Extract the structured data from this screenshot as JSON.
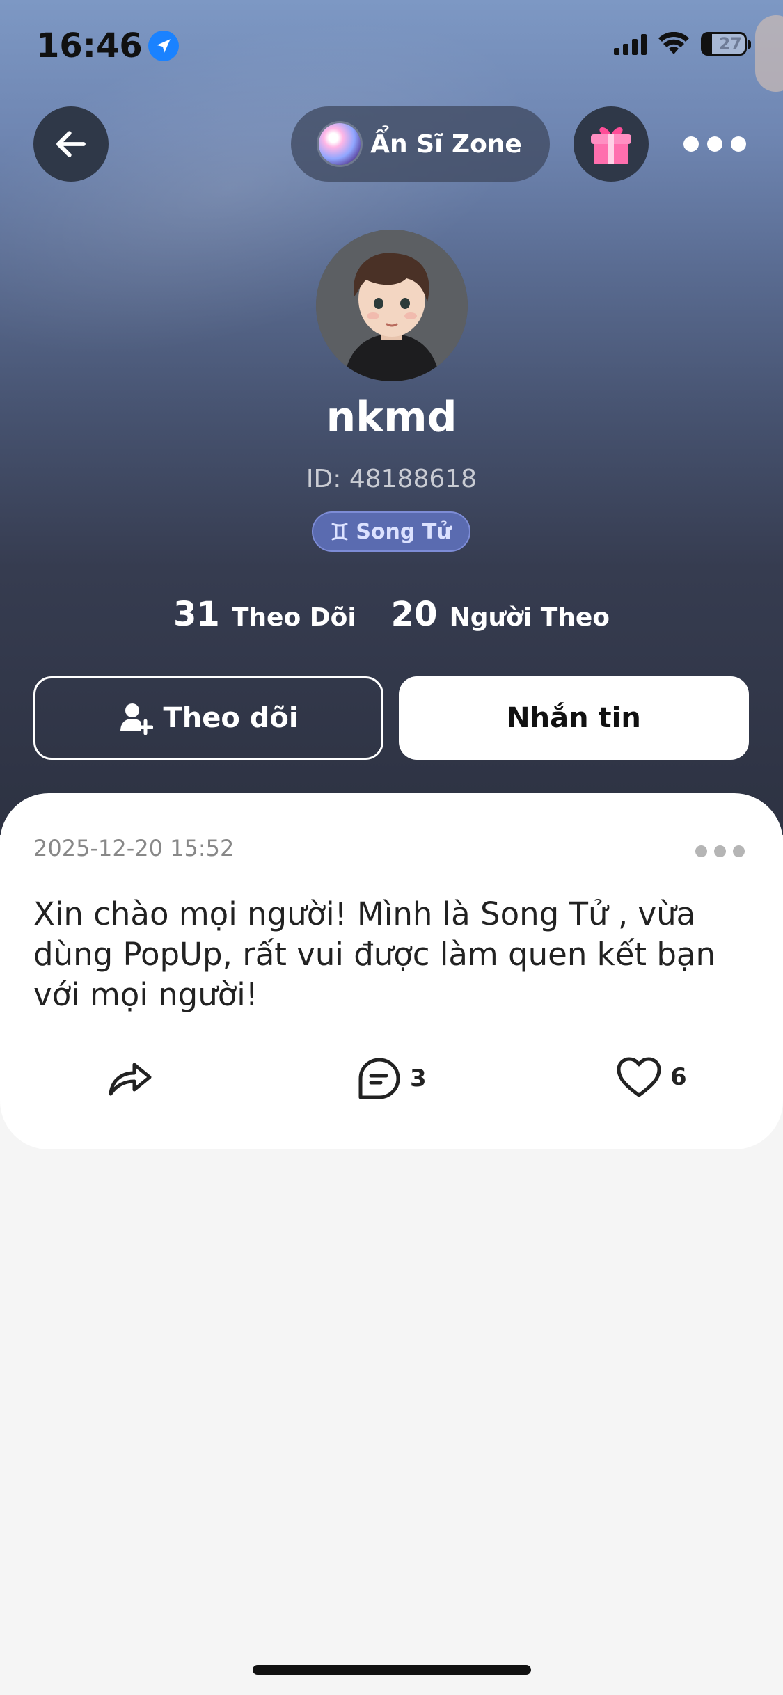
{
  "status_bar": {
    "time": "16:46",
    "battery": "27"
  },
  "header": {
    "zone_label": "Ẩn Sĩ Zone"
  },
  "profile": {
    "username": "nkmd",
    "id_text": "ID: 48188618",
    "zodiac_label": "Song Tử",
    "following_count": "31",
    "following_label": "Theo Dõi",
    "followers_count": "20",
    "followers_label": "Người Theo",
    "follow_button": "Theo dõi",
    "message_button": "Nhắn tin"
  },
  "post": {
    "timestamp": "2025-12-20 15:52",
    "text": "Xin chào mọi người! Mình là Song Tử , vừa dùng PopUp, rất vui được làm quen kết bạn với mọi người!",
    "comment_count": "3",
    "like_count": "6"
  }
}
